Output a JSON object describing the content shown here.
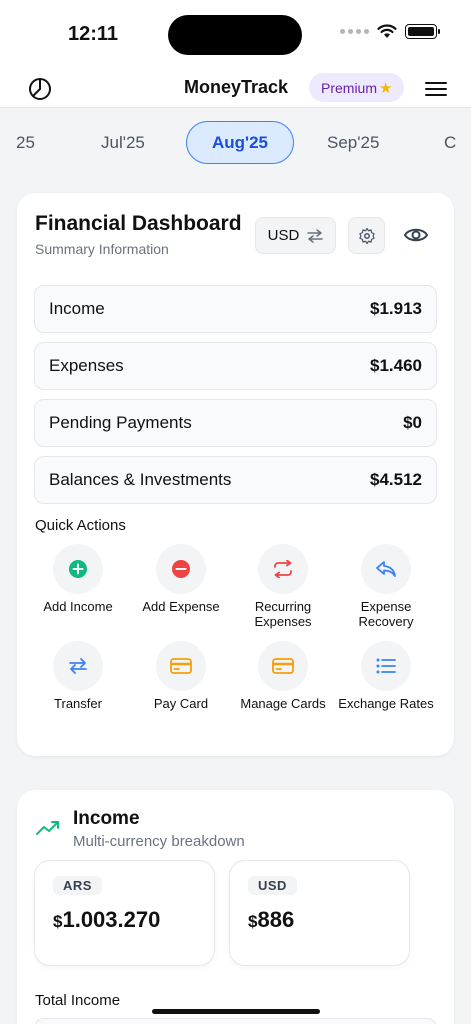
{
  "status_bar": {
    "time": "12:11"
  },
  "header": {
    "app_title": "MoneyTrack",
    "premium_label": "Premium",
    "premium_star": "★"
  },
  "months": {
    "items": [
      "25",
      "Jul'25",
      "Aug'25",
      "Sep'25",
      "C"
    ],
    "active": "Aug'25"
  },
  "dashboard": {
    "title": "Financial Dashboard",
    "subtitle": "Summary Information",
    "currency_button": "USD",
    "summary": [
      {
        "label": "Income",
        "value": "$1.913"
      },
      {
        "label": "Expenses",
        "value": "$1.460"
      },
      {
        "label": "Pending Payments",
        "value": "$0"
      },
      {
        "label": "Balances & Investments",
        "value": "$4.512"
      }
    ],
    "quick_actions_title": "Quick Actions",
    "quick_actions": [
      {
        "label": "Add Income",
        "icon": "plus-circle-icon",
        "color": "#10b981"
      },
      {
        "label": "Add Expense",
        "icon": "minus-circle-icon",
        "color": "#ef4444"
      },
      {
        "label": "Recurring Expenses",
        "icon": "repeat-icon",
        "color": "#ef4444"
      },
      {
        "label": "Expense Recovery",
        "icon": "undo-arrow-icon",
        "color": "#3b82f6"
      },
      {
        "label": "Transfer",
        "icon": "transfer-arrows-icon",
        "color": "#3b82f6"
      },
      {
        "label": "Pay Card",
        "icon": "credit-card-icon",
        "color": "#f59e0b"
      },
      {
        "label": "Manage Cards",
        "icon": "credit-card-icon",
        "color": "#f59e0b"
      },
      {
        "label": "Exchange Rates",
        "icon": "list-icon",
        "color": "#3b82f6"
      }
    ]
  },
  "income": {
    "title": "Income",
    "subtitle": "Multi-currency breakdown",
    "currencies": [
      {
        "code": "ARS",
        "symbol": "$",
        "amount": "1.003.270"
      },
      {
        "code": "USD",
        "symbol": "$",
        "amount": "886"
      }
    ],
    "total_label": "Total Income"
  },
  "colors": {
    "accent": "#3b82f6",
    "premium_bg": "#ede9fe",
    "premium_text": "#6b21a8",
    "income_green": "#10b981"
  }
}
